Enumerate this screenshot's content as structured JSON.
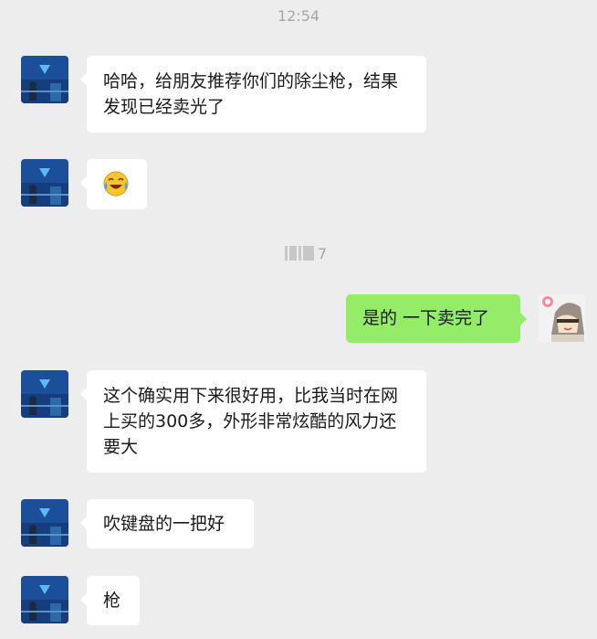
{
  "chat": {
    "timestamp": "12:54",
    "divider_suffix": "7",
    "messages": [
      {
        "side": "left",
        "type": "text",
        "text": "哈哈，给朋友推荐你们的除尘枪，结果发现已经卖光了"
      },
      {
        "side": "left",
        "type": "emoji",
        "emoji": "crying-laughing-emoji"
      },
      {
        "side": "right",
        "type": "text",
        "text": "是的 一下卖完了"
      },
      {
        "side": "left",
        "type": "text",
        "text": "这个确实用下来很好用，比我当时在网上买的300多，外形非常炫酷的风力还要大"
      },
      {
        "side": "left",
        "type": "text",
        "text": "吹键盘的一把好"
      },
      {
        "side": "left",
        "type": "text",
        "text": "枪"
      }
    ]
  },
  "colors": {
    "background": "#ededed",
    "bubble_left": "#ffffff",
    "bubble_right": "#95ec69"
  }
}
